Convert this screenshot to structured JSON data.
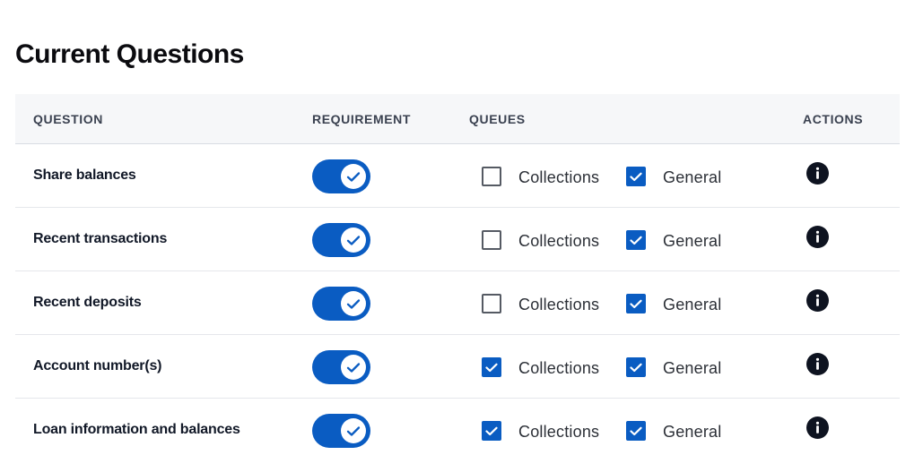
{
  "page": {
    "title": "Current Questions"
  },
  "table": {
    "headers": {
      "question": "QUESTION",
      "requirement": "REQUIREMENT",
      "queues": "QUEUES",
      "actions": "ACTIONS"
    },
    "rows": [
      {
        "question": "Share balances",
        "required": true,
        "queues": {
          "collections_label": "Collections",
          "collections": false,
          "general_label": "General",
          "general": true
        },
        "action_icon": "info-icon"
      },
      {
        "question": "Recent transactions",
        "required": true,
        "queues": {
          "collections_label": "Collections",
          "collections": false,
          "general_label": "General",
          "general": true
        },
        "action_icon": "info-icon"
      },
      {
        "question": "Recent deposits",
        "required": true,
        "queues": {
          "collections_label": "Collections",
          "collections": false,
          "general_label": "General",
          "general": true
        },
        "action_icon": "info-icon"
      },
      {
        "question": "Account number(s)",
        "required": true,
        "queues": {
          "collections_label": "Collections",
          "collections": true,
          "general_label": "General",
          "general": true
        },
        "action_icon": "info-icon"
      },
      {
        "question": "Loan information and balances",
        "required": true,
        "queues": {
          "collections_label": "Collections",
          "collections": true,
          "general_label": "General",
          "general": true
        },
        "action_icon": "info-icon"
      }
    ]
  },
  "colors": {
    "accent": "#0a5cc2",
    "header_bg": "#f6f7f9",
    "info_icon": "#0e1320"
  }
}
